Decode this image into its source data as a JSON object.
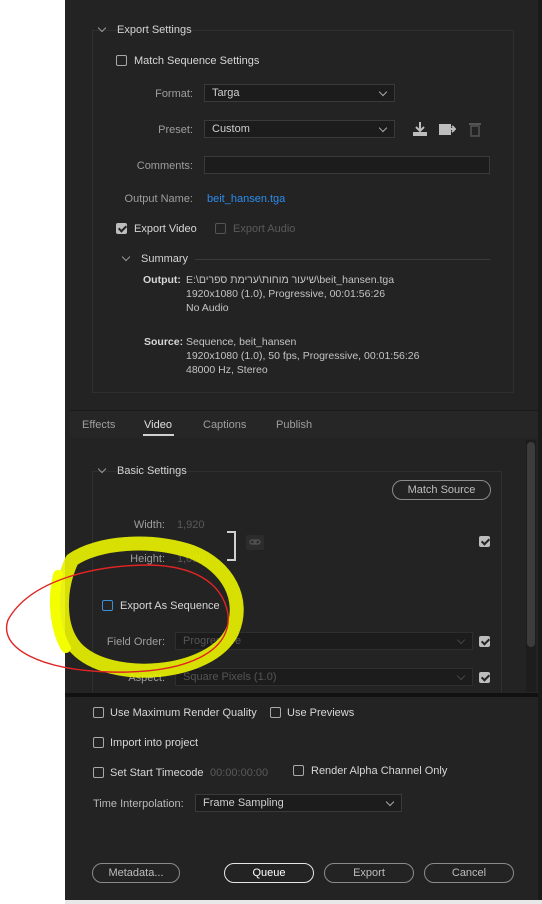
{
  "export_settings": {
    "header": "Export Settings",
    "match_sequence_label": "Match Sequence Settings",
    "format_label": "Format:",
    "format_value": "Targa",
    "preset_label": "Preset:",
    "preset_value": "Custom",
    "comments_label": "Comments:",
    "comments_value": "",
    "output_name_label": "Output Name:",
    "output_name_value": "beit_hansen.tga",
    "export_video_label": "Export Video",
    "export_audio_label": "Export Audio",
    "export_video_checked": true,
    "export_audio_checked": false
  },
  "summary": {
    "header": "Summary",
    "output_label": "Output:",
    "output_lines": [
      "E:\\שיעור מוחות\\ערימת ספרים\\beit_hansen.tga",
      "1920x1080 (1.0), Progressive, 00:01:56:26",
      "No Audio"
    ],
    "source_label": "Source:",
    "source_lines": [
      "Sequence, beit_hansen",
      "1920x1080 (1.0), 50 fps, Progressive, 00:01:56:26",
      "48000 Hz, Stereo"
    ]
  },
  "tabs": [
    {
      "label": "Effects"
    },
    {
      "label": "Video"
    },
    {
      "label": "Captions"
    },
    {
      "label": "Publish"
    }
  ],
  "active_tab": "Video",
  "basic_settings": {
    "header": "Basic Settings",
    "match_source_label": "Match Source",
    "width_label": "Width:",
    "width_value": "1,920",
    "height_label": "Height:",
    "height_value": "1,080",
    "export_as_sequence_label": "Export As Sequence",
    "field_order_label": "Field Order:",
    "field_order_value": "Progressive",
    "aspect_label": "Aspect:",
    "aspect_value": "Square Pixels (1.0)"
  },
  "bottom": {
    "max_render_quality": "Use Maximum Render Quality",
    "use_previews": "Use Previews",
    "import_into_project": "Import into project",
    "set_start_timecode": "Set Start Timecode",
    "start_timecode_value": "00:00:00:00",
    "render_alpha": "Render Alpha Channel Only",
    "time_interpolation_label": "Time Interpolation:",
    "time_interpolation_value": "Frame Sampling"
  },
  "buttons": {
    "metadata": "Metadata...",
    "queue": "Queue",
    "export": "Export",
    "cancel": "Cancel"
  },
  "colors": {
    "panel_bg": "#232323",
    "link": "#2d8ceb",
    "annotation_yellow": "#f0ff00",
    "annotation_red": "#e02424"
  }
}
